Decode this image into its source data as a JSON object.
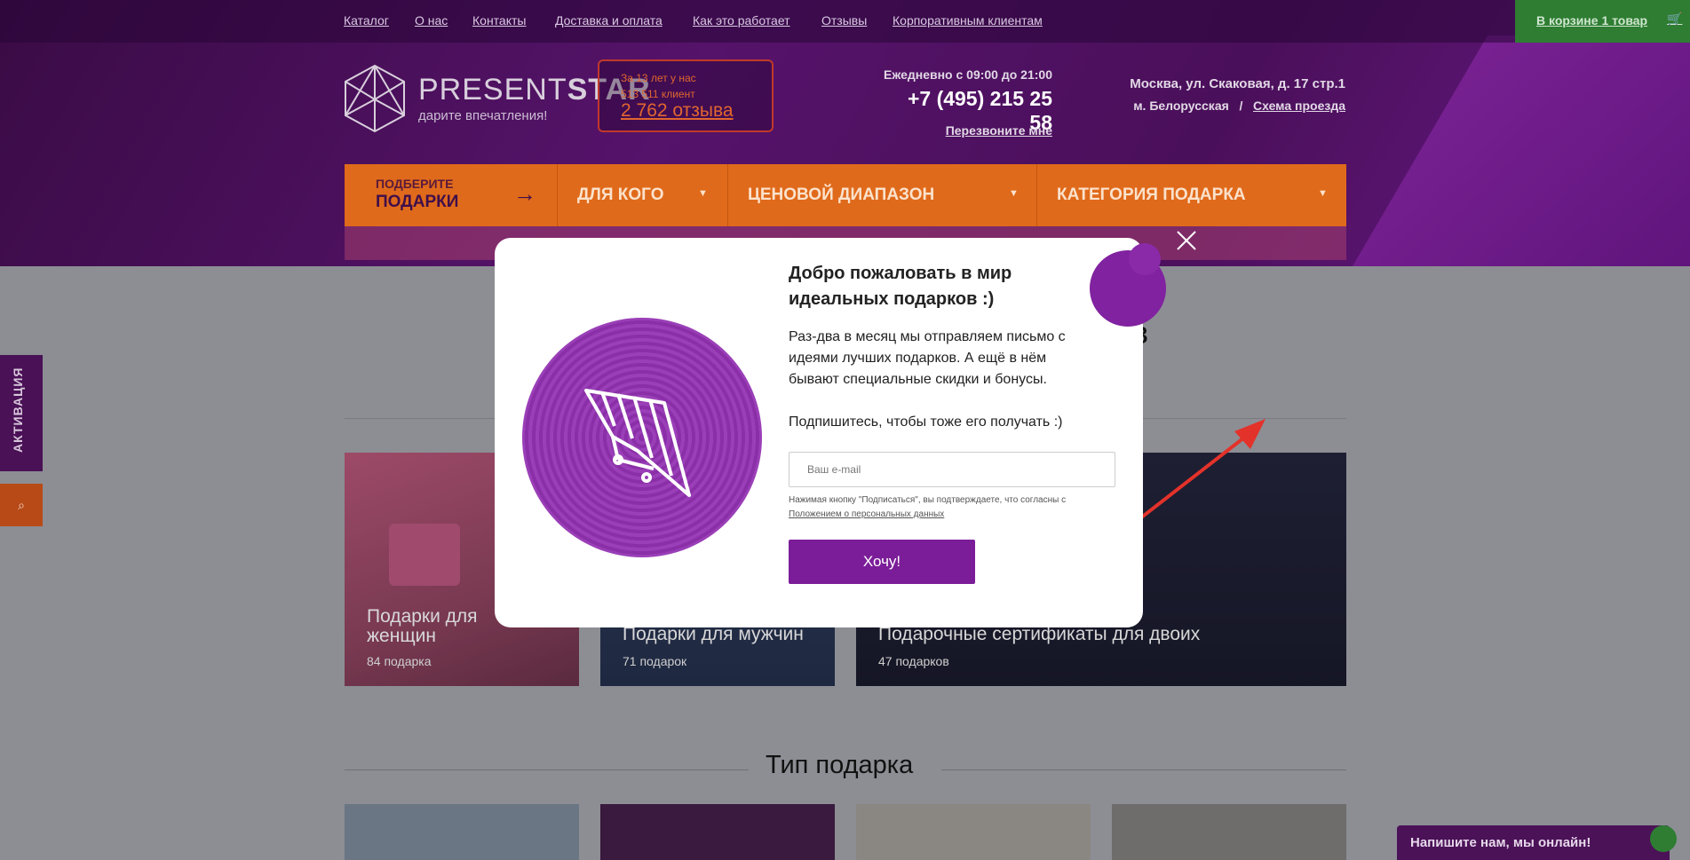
{
  "topnav": {
    "links": [
      "Каталог",
      "О нас",
      "Контакты",
      "Доставка и оплата",
      "Как это работает",
      "Отзывы",
      "Корпоративным клиентам"
    ],
    "cart_label": "В корзине 1 товар"
  },
  "logo": {
    "name_light": "PRESENT",
    "name_bold": "STAR",
    "tagline": "дарите впечатления!"
  },
  "reviews": {
    "line1": "За 13 лет у нас",
    "line2": "513 511 клиент",
    "link": "2 762 отзыва"
  },
  "contacts": {
    "hours": "Ежедневно с 09:00 до 21:00",
    "phone": "+7 (495) 215 25 58",
    "callback": "Перезвоните мне",
    "address": "Москва, ул. Скаковая, д. 17 стр.1",
    "metro": "м. Белорусская",
    "separator": "/",
    "route": "Схема проезда"
  },
  "filterbar": {
    "pick_small": "ПОДБЕРИТЕ",
    "pick_big": "ПОДАРКИ",
    "for_whom": "ДЛЯ КОГО",
    "price": "ЦЕНОВОЙ ДИАПАЗОН",
    "category": "КАТЕГОРИЯ ПОДАРКА"
  },
  "main": {
    "title_fragment": "ов",
    "cards": [
      {
        "title": "Подарки для женщин",
        "count": "84 подарка"
      },
      {
        "title": "Подарки для мужчин",
        "count": "71 подарок"
      },
      {
        "title": "Подарочные сертификаты для двоих",
        "count": "47 подарков"
      }
    ],
    "section_title": "Тип подарка"
  },
  "side": {
    "activation": "АКТИВАЦИЯ"
  },
  "chat": {
    "label": "Напишите нам, мы онлайн!"
  },
  "modal": {
    "title": "Добро пожаловать в мир идеальных подарков :)",
    "text": "Раз-два в месяц мы отправляем письмо с идеями лучших подарков. А ещё в нём бывают специальные скидки и бонусы.",
    "text2": "Подпишитесь, чтобы тоже его получать :)",
    "email_placeholder": "Ваш e-mail",
    "consent_prefix": "Нажимая кнопку \"Подписаться\", вы подтверждаете, что согласны с ",
    "consent_link": "Положением о персональных данных",
    "submit": "Хочу!"
  },
  "colors": {
    "accent": "#7b1d98",
    "orange": "#e06a1b",
    "cart_green": "#2e7d32"
  }
}
